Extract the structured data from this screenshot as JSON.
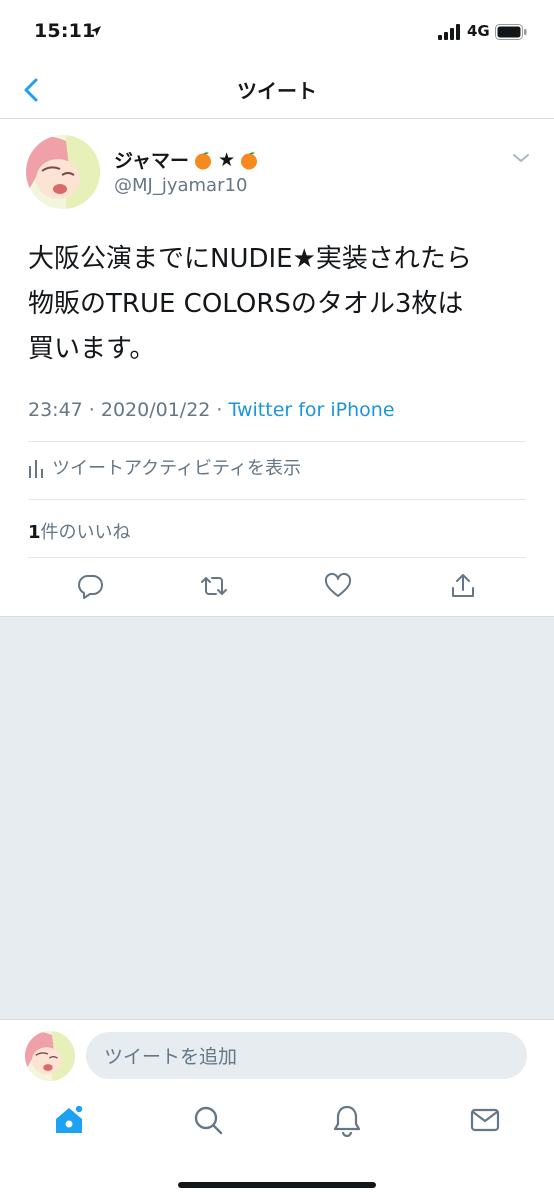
{
  "status_bar": {
    "time": "15:11",
    "network": "4G"
  },
  "nav": {
    "title": "ツイート"
  },
  "tweet": {
    "display_name": "ジャマー",
    "name_star": "★",
    "handle": "@MJ_jyamar10",
    "text_lines": [
      "大阪公演までにNUDIE★実装されたら",
      "物販のTRUE COLORSのタオル3枚は",
      "買います。"
    ],
    "timestamp": "23:47 · 2020/01/22 · ",
    "source": "Twitter for iPhone",
    "activity_label": "ツイートアクティビティを表示",
    "likes_count": "1",
    "likes_label": "件のいいね"
  },
  "reply": {
    "placeholder": "ツイートを追加"
  },
  "icons": {
    "back": "chevron-left-icon",
    "caret": "chevron-down-icon",
    "reply": "comment-icon",
    "retweet": "retweet-icon",
    "like": "heart-icon",
    "share": "share-icon",
    "home": "home-icon",
    "search": "search-icon",
    "notifications": "bell-icon",
    "messages": "mail-icon"
  },
  "colors": {
    "accent": "#1da1f2",
    "link": "#1b95e0",
    "muted": "#657786",
    "bg_gray": "#e6ecf0"
  }
}
